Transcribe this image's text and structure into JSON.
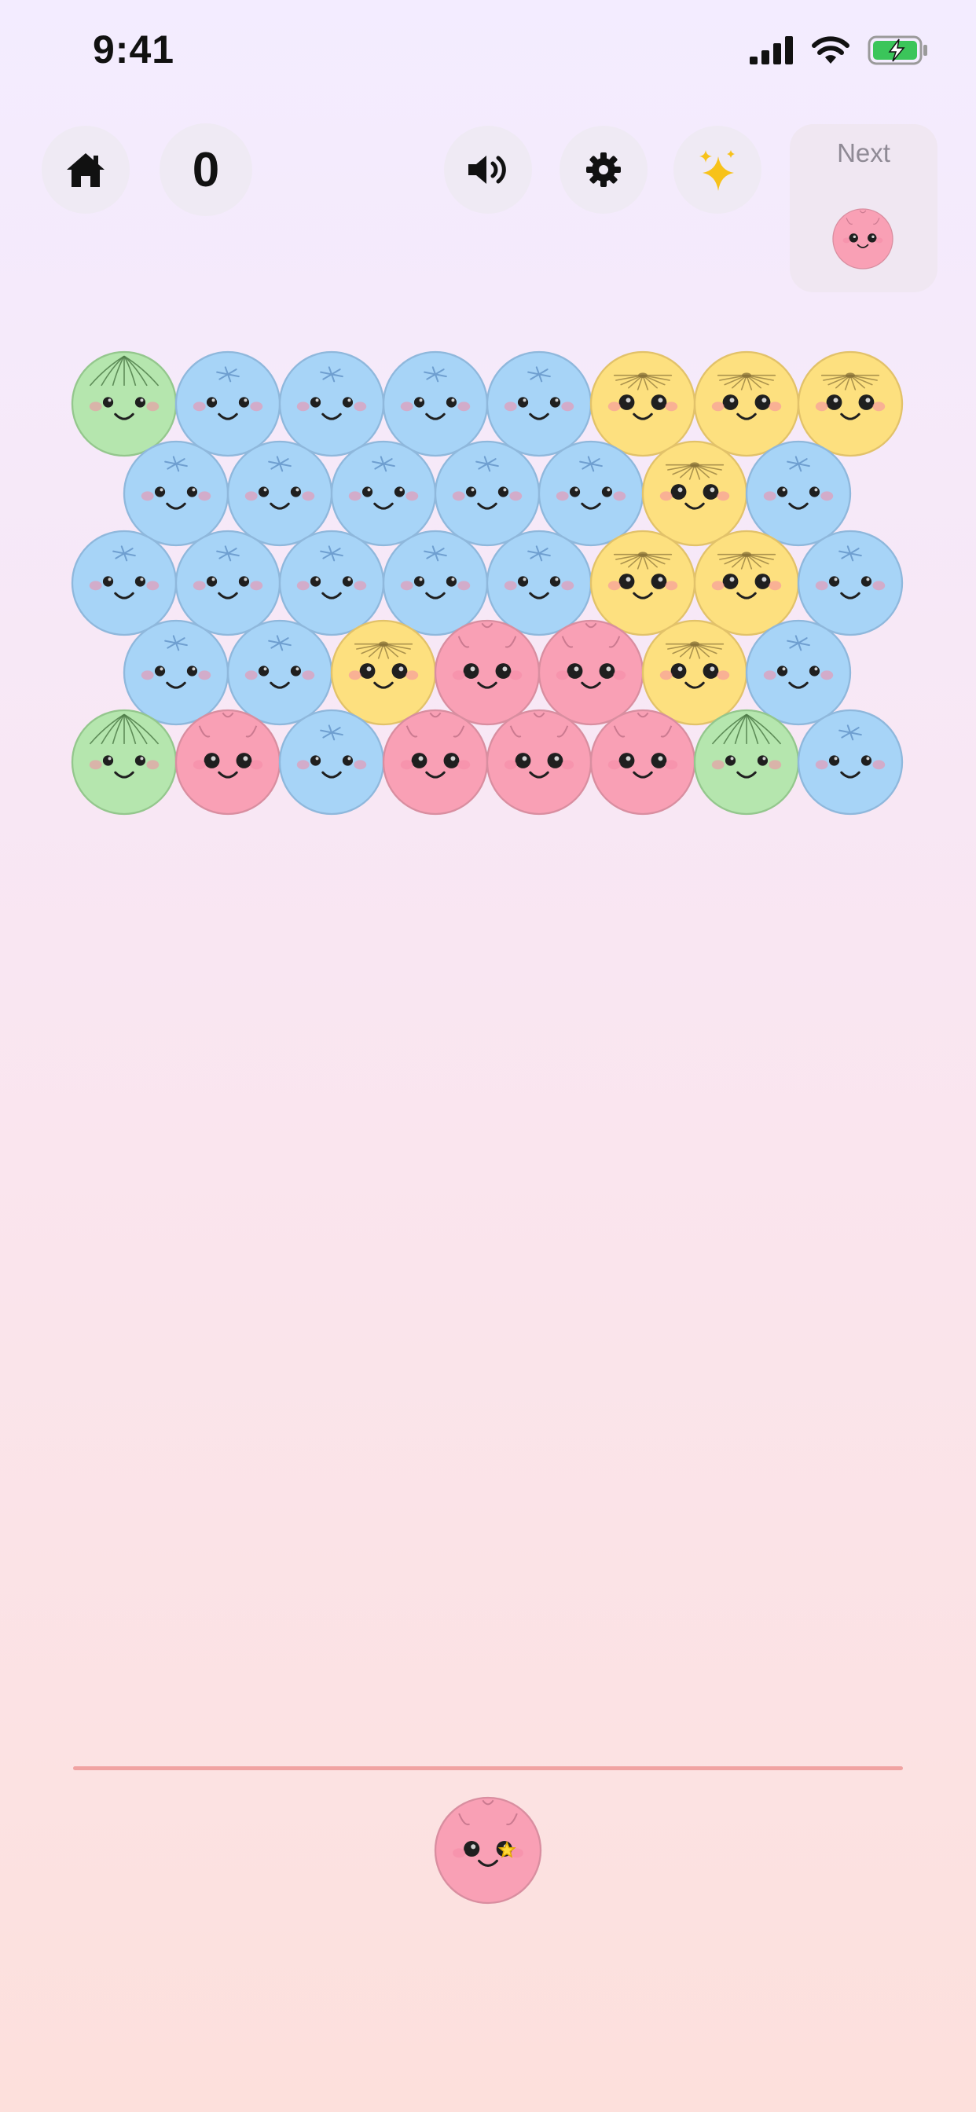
{
  "status_bar": {
    "time": "9:41",
    "icons": [
      "signal-icon",
      "wifi-icon",
      "battery-charging-icon"
    ]
  },
  "toolbar": {
    "home_icon": "home-icon",
    "score": "0",
    "sound_icon": "speaker-icon",
    "settings_icon": "gear-icon",
    "powerup_icon": "sparkles-icon"
  },
  "next_preview": {
    "label": "Next",
    "bubble": "pink"
  },
  "shooter": {
    "bubble": "pink",
    "badge": "star"
  },
  "colors": {
    "blue": "#a7d4f7",
    "yellow": "#fde07f",
    "pink": "#f9a0b5",
    "green": "#b5e6ae"
  },
  "grid": [
    [
      "green",
      "blue",
      "blue",
      "blue",
      "blue",
      "yellow",
      "yellow",
      "yellow"
    ],
    [
      "blue",
      "blue",
      "blue",
      "blue",
      "blue",
      "yellow",
      "blue"
    ],
    [
      "blue",
      "blue",
      "blue",
      "blue",
      "blue",
      "yellow",
      "yellow",
      "blue"
    ],
    [
      "blue",
      "blue",
      "yellow",
      "pink",
      "pink",
      "yellow",
      "blue"
    ],
    [
      "green",
      "pink",
      "blue",
      "pink",
      "pink",
      "pink",
      "green",
      "blue"
    ]
  ]
}
